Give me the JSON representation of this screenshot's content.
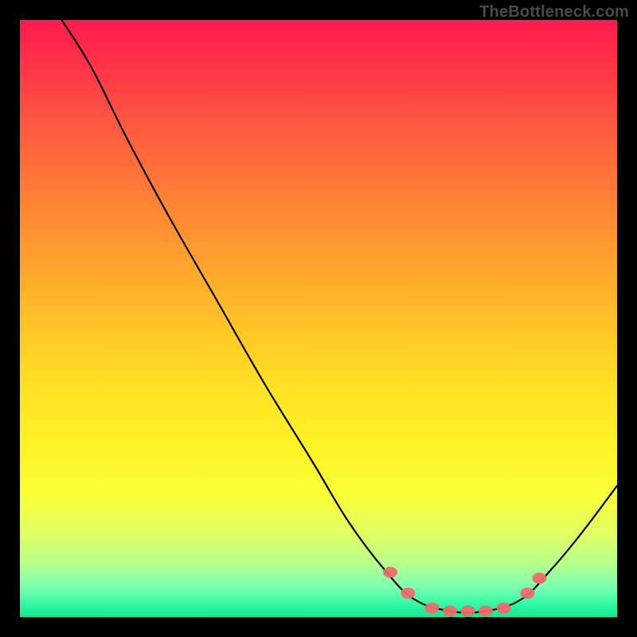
{
  "watermark": "TheBottleneck.com",
  "colors": {
    "background": "#000000",
    "curve": "#000000",
    "marker": "#ed6d6d",
    "gradient_top": "#ff1a4d",
    "gradient_bottom": "#13e892"
  },
  "chart_data": {
    "type": "line",
    "title": "",
    "subtitle": "",
    "xlabel": "",
    "ylabel": "",
    "xlim": [
      0,
      100
    ],
    "ylim": [
      0,
      100
    ],
    "grid": false,
    "legend": false,
    "axes_visible": false,
    "curve": [
      {
        "x": 7,
        "y": 100
      },
      {
        "x": 12,
        "y": 92
      },
      {
        "x": 18,
        "y": 80
      },
      {
        "x": 25,
        "y": 67
      },
      {
        "x": 33,
        "y": 53
      },
      {
        "x": 41,
        "y": 39
      },
      {
        "x": 49,
        "y": 26
      },
      {
        "x": 55,
        "y": 16
      },
      {
        "x": 61,
        "y": 8
      },
      {
        "x": 66,
        "y": 3
      },
      {
        "x": 72,
        "y": 1
      },
      {
        "x": 78,
        "y": 1
      },
      {
        "x": 84,
        "y": 3
      },
      {
        "x": 89,
        "y": 8
      },
      {
        "x": 94,
        "y": 14
      },
      {
        "x": 100,
        "y": 22
      }
    ],
    "markers": [
      {
        "x": 62,
        "y": 7.5
      },
      {
        "x": 65,
        "y": 4
      },
      {
        "x": 69,
        "y": 1.5
      },
      {
        "x": 72,
        "y": 1
      },
      {
        "x": 75,
        "y": 1
      },
      {
        "x": 78,
        "y": 1
      },
      {
        "x": 81,
        "y": 1.5
      },
      {
        "x": 85,
        "y": 4
      },
      {
        "x": 87,
        "y": 6.5
      }
    ]
  }
}
